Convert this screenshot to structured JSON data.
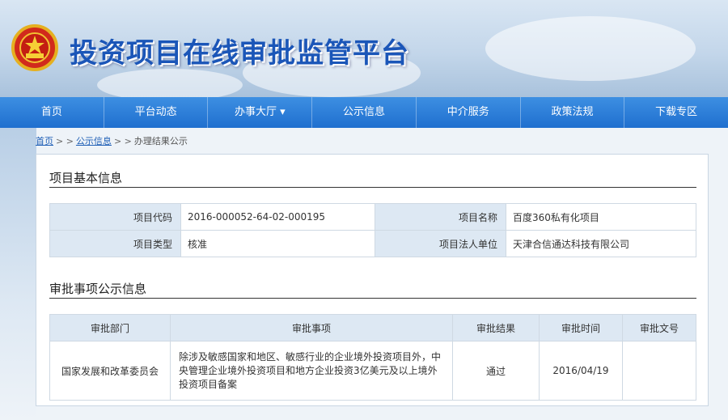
{
  "header": {
    "site_title": "投资项目在线审批监管平台",
    "emblem_icon": "national-emblem-icon"
  },
  "nav": {
    "items": [
      {
        "label": "首页"
      },
      {
        "label": "平台动态"
      },
      {
        "label": "办事大厅 ▾"
      },
      {
        "label": "公示信息"
      },
      {
        "label": "中介服务"
      },
      {
        "label": "政策法规"
      },
      {
        "label": "下载专区"
      }
    ]
  },
  "breadcrumb": {
    "home": "首页",
    "sep1": "> >",
    "section": "公示信息",
    "sep2": "> >",
    "current": "办理结果公示"
  },
  "basic_info": {
    "title": "项目基本信息",
    "code_label": "项目代码",
    "code_value": "2016-000052-64-02-000195",
    "name_label": "项目名称",
    "name_value": "百度360私有化项目",
    "type_label": "项目类型",
    "type_value": "核准",
    "unit_label": "项目法人单位",
    "unit_value": "天津合信通达科技有限公司"
  },
  "approval": {
    "title": "审批事项公示信息",
    "headers": [
      "审批部门",
      "审批事项",
      "审批结果",
      "审批时间",
      "审批文号"
    ],
    "rows": [
      {
        "dept": "国家发展和改革委员会",
        "item": "除涉及敏感国家和地区、敏感行业的企业境外投资项目外，中央管理企业境外投资项目和地方企业投资3亿美元及以上境外投资项目备案",
        "result": "通过",
        "time": "2016/04/19",
        "doc_no": ""
      }
    ]
  },
  "colors": {
    "nav_blue": "#2a7bd8",
    "title_blue": "#1b56b8",
    "label_bg": "#dde8f3"
  }
}
